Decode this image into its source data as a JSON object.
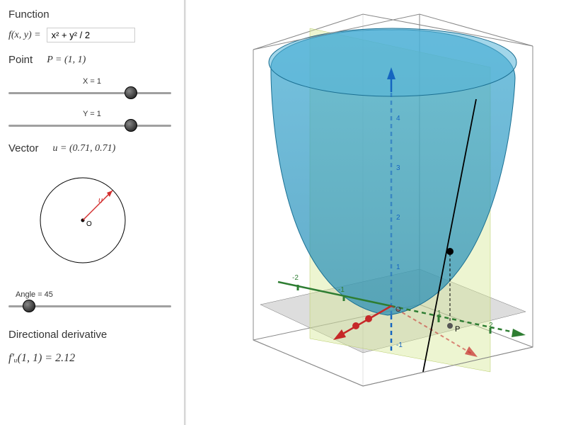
{
  "function": {
    "section_label": "Function",
    "prefix": "f(x, y)  =",
    "expression": "x² + y² / 2"
  },
  "point": {
    "section_label": "Point",
    "display": "P = (1, 1)",
    "x_slider": {
      "caption": "X = 1",
      "value": 1,
      "min": -2,
      "max": 2
    },
    "y_slider": {
      "caption": "Y = 1",
      "value": 1,
      "min": -2,
      "max": 2
    }
  },
  "vector": {
    "section_label": "Vector",
    "display": "u = (0.71, 0.71)",
    "u_label": "u",
    "origin_label": "O"
  },
  "angle": {
    "caption": "Angle = 45",
    "value": 45,
    "min": 0,
    "max": 360
  },
  "derivative": {
    "section_label": "Directional derivative",
    "display": "f′ᵤ(1, 1) = 2.12",
    "value": 2.12
  },
  "viz3d": {
    "axes": {
      "x_color": "#c62828",
      "y_color": "#2e7d32",
      "z_color": "#1565c0"
    },
    "surface_color": "#2a9bc4",
    "plane_color": "#d8e89a",
    "floor_color": "#9e9e9e",
    "point_label": "P",
    "origin_label": "O",
    "z_ticks": [
      -1,
      1,
      2,
      3,
      4
    ],
    "xy_ticks": [
      -2,
      -1,
      1,
      2
    ]
  },
  "chart_data": {
    "type": "3d-plot",
    "function": "f(x,y) = x^2 + y^2/2",
    "point": {
      "x": 1,
      "y": 1
    },
    "direction_vector": {
      "ux": 0.71,
      "uy": 0.71,
      "angle_deg": 45
    },
    "directional_derivative": 2.12,
    "axis_range": {
      "x": [
        -2,
        2
      ],
      "y": [
        -2,
        2
      ],
      "z": [
        -1,
        5
      ]
    }
  }
}
